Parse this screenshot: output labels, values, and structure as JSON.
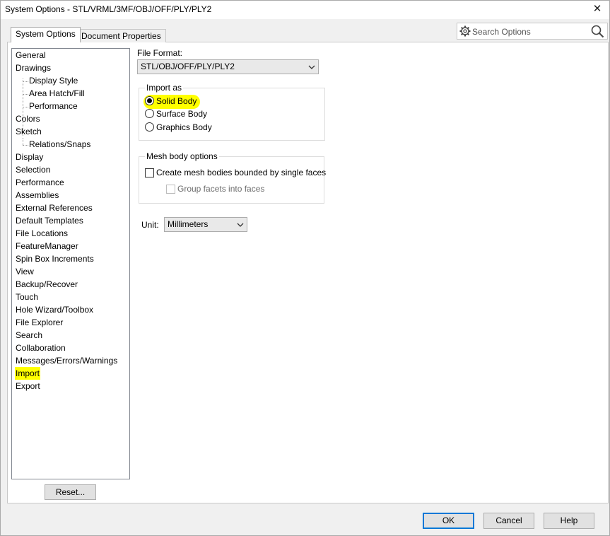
{
  "window": {
    "title": "System Options - STL/VRML/3MF/OBJ/OFF/PLY/PLY2",
    "close_glyph": "✕"
  },
  "tabs": [
    {
      "label": "System Options",
      "active": true
    },
    {
      "label": "Document Properties",
      "active": false
    }
  ],
  "search": {
    "placeholder": "Search Options",
    "icons": [
      "gear-icon",
      "search-icon"
    ]
  },
  "tree": {
    "items": [
      {
        "label": "General"
      },
      {
        "label": "Drawings"
      },
      {
        "label": "Display Style"
      },
      {
        "label": "Area Hatch/Fill"
      },
      {
        "label": "Performance"
      },
      {
        "label": "Colors"
      },
      {
        "label": "Sketch"
      },
      {
        "label": "Relations/Snaps"
      },
      {
        "label": "Display"
      },
      {
        "label": "Selection"
      },
      {
        "label": "Performance"
      },
      {
        "label": "Assemblies"
      },
      {
        "label": "External References"
      },
      {
        "label": "Default Templates"
      },
      {
        "label": "File Locations"
      },
      {
        "label": "FeatureManager"
      },
      {
        "label": "Spin Box Increments"
      },
      {
        "label": "View"
      },
      {
        "label": "Backup/Recover"
      },
      {
        "label": "Touch"
      },
      {
        "label": "Hole Wizard/Toolbox"
      },
      {
        "label": "File Explorer"
      },
      {
        "label": "Search"
      },
      {
        "label": "Collaboration"
      },
      {
        "label": "Messages/Errors/Warnings"
      },
      {
        "label": "Import"
      },
      {
        "label": "Export"
      }
    ],
    "selected": "Import",
    "reset_label": "Reset..."
  },
  "main": {
    "file_format_label": "File Format:",
    "file_format_value": "STL/OBJ/OFF/PLY/PLY2",
    "import_as": {
      "legend": "Import as",
      "options": [
        "Solid Body",
        "Surface Body",
        "Graphics Body"
      ],
      "selected": "Solid Body"
    },
    "mesh": {
      "legend": "Mesh body options",
      "create_label": "Create mesh bodies bounded by single faces",
      "create_checked": false,
      "group_label": "Group facets into faces",
      "group_checked": false,
      "group_enabled": false
    },
    "unit_label": "Unit:",
    "unit_value": "Millimeters"
  },
  "footer": {
    "ok": "OK",
    "cancel": "Cancel",
    "help": "Help"
  },
  "colors": {
    "highlight": "#ffff00",
    "default_button_border": "#0078d7"
  }
}
